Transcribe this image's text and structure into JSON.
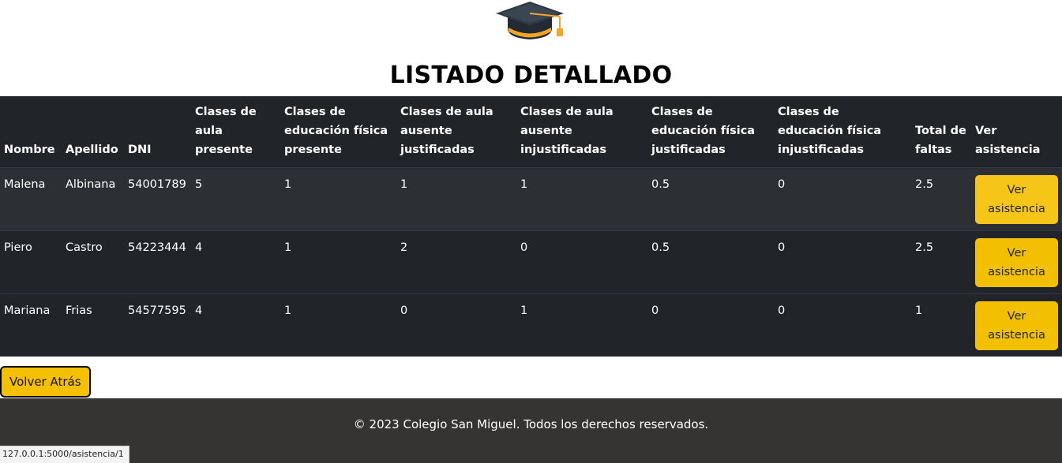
{
  "header": {
    "logo_icon": "graduation-cap-icon",
    "title": "LISTADO DETALLADO"
  },
  "table": {
    "columns": [
      "Nombre",
      "Apellido",
      "DNI",
      "Clases de aula presente",
      "Clases de educación física presente",
      "Clases de aula ausente justificadas",
      "Clases de aula ausente injustificadas",
      "Clases de educación física justificadas",
      "Clases de educación física injustificadas",
      "Total de faltas",
      "Ver asistencia"
    ],
    "rows": [
      [
        "Malena",
        "Albinana",
        "54001789",
        "5",
        "1",
        "1",
        "1",
        "0.5",
        "0",
        "2.5"
      ],
      [
        "Piero",
        "Castro",
        "54223444",
        "4",
        "1",
        "2",
        "0",
        "0.5",
        "0",
        "2.5"
      ],
      [
        "Mariana",
        "Frias",
        "54577595",
        "4",
        "1",
        "0",
        "1",
        "0",
        "0",
        "1"
      ]
    ],
    "action_label": "Ver asistencia"
  },
  "back_button": "Volver Atrás",
  "footer": {
    "text": "© 2023 Colegio San Miguel. Todos los derechos reservados."
  },
  "status_bar": {
    "url": "127.0.0.1:5000/asistencia/1"
  },
  "colors": {
    "table_dark": "#212529",
    "table_striped": "#2c3034",
    "accent_yellow": "#f5c518",
    "footer_bg": "#353432"
  }
}
